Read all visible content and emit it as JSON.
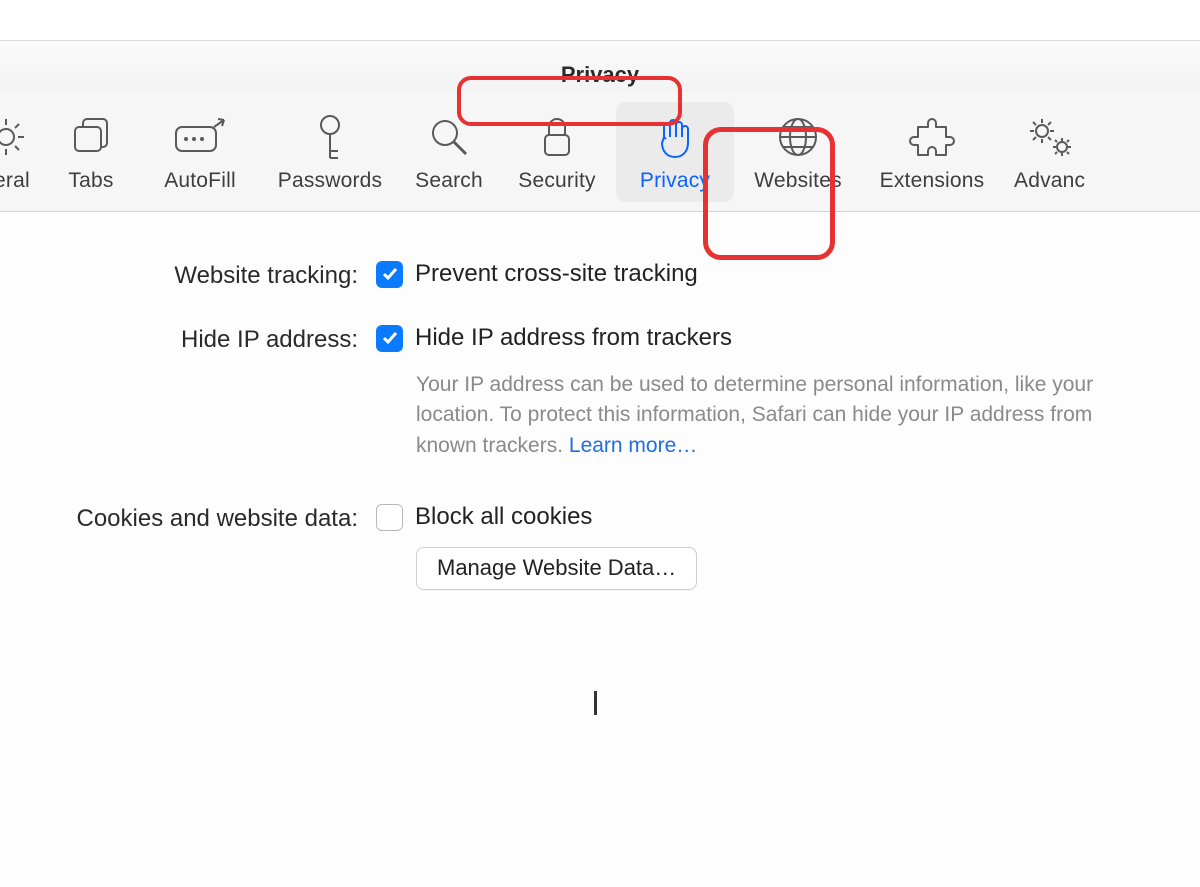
{
  "window": {
    "title": "Privacy"
  },
  "tabs": {
    "general": {
      "label": "neral"
    },
    "tabs": {
      "label": "Tabs"
    },
    "autofill": {
      "label": "AutoFill"
    },
    "passwords": {
      "label": "Passwords"
    },
    "search": {
      "label": "Search"
    },
    "security": {
      "label": "Security"
    },
    "privacy": {
      "label": "Privacy"
    },
    "websites": {
      "label": "Websites"
    },
    "extensions": {
      "label": "Extensions"
    },
    "advanced": {
      "label": "Advanc"
    }
  },
  "sections": {
    "tracking": {
      "label": "Website tracking:",
      "opt": "Prevent cross-site tracking",
      "checked": true
    },
    "hideip": {
      "label": "Hide IP address:",
      "opt": "Hide IP address from trackers",
      "checked": true,
      "help": "Your IP address can be used to determine personal information, like your location. To protect this information, Safari can hide your IP address from known trackers. ",
      "learn": "Learn more…"
    },
    "cookies": {
      "label": "Cookies and website data:",
      "opt": "Block all cookies",
      "checked": false,
      "button": "Manage Website Data…"
    }
  }
}
